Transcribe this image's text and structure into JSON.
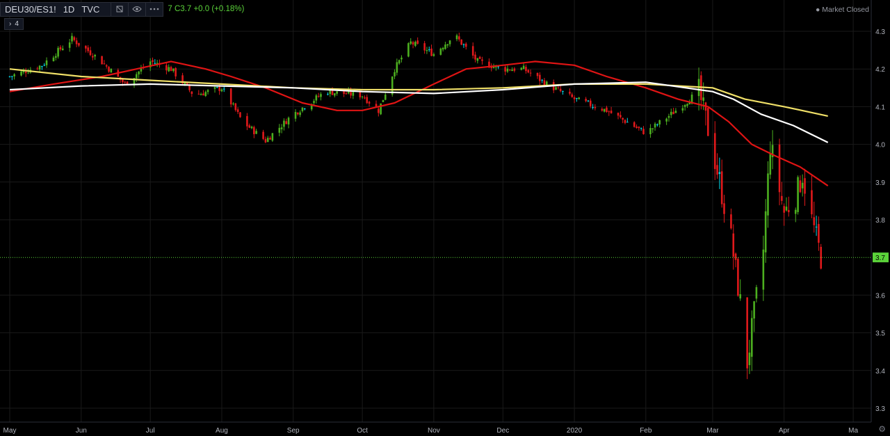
{
  "symbol": {
    "name": "DEU30/ES1!",
    "interval": "1D",
    "source": "TVC"
  },
  "ohlc_text": {
    "prefix": "7",
    "close": "C3.7",
    "change": "+0.0 (+0.18%)"
  },
  "indicators_toggle": "4",
  "market_status": "Market Closed",
  "icons": {
    "flag": "flag-icon",
    "eye": "eye-icon",
    "more": "more-icon",
    "gear": "gear-icon",
    "chevron": "chevron-right-icon"
  },
  "colors": {
    "background": "#000000",
    "grid": "#1a1a1a",
    "up": "#4caf1f",
    "down": "#e0191b",
    "doji": "#00d9e8",
    "ma_fast": "#e01414",
    "ma_mid": "#f0e068",
    "ma_slow": "#ffffff",
    "last_price": "#5bd33a",
    "axis_text": "#b2b5be"
  },
  "chart_data": {
    "type": "candlestick",
    "title": "DEU30/ES1!",
    "interval": "1D",
    "y_range": [
      3.29,
      4.33
    ],
    "x_range": [
      "2019-05-01",
      "2020-05-07"
    ],
    "y_ticks": [
      "4.3",
      "4.2",
      "4.1",
      "4.0",
      "3.9",
      "3.8",
      "3.6",
      "3.5",
      "3.4",
      "3.3"
    ],
    "x_ticks": [
      {
        "date": "2019-05-01",
        "label": "May"
      },
      {
        "date": "2019-06-01",
        "label": "Jun"
      },
      {
        "date": "2019-07-01",
        "label": "Jul"
      },
      {
        "date": "2019-08-01",
        "label": "Aug"
      },
      {
        "date": "2019-09-01",
        "label": "Sep"
      },
      {
        "date": "2019-10-01",
        "label": "Oct"
      },
      {
        "date": "2019-11-01",
        "label": "Nov"
      },
      {
        "date": "2019-12-01",
        "label": "Dec"
      },
      {
        "date": "2020-01-01",
        "label": "2020"
      },
      {
        "date": "2020-02-01",
        "label": "Feb"
      },
      {
        "date": "2020-03-01",
        "label": "Mar"
      },
      {
        "date": "2020-04-01",
        "label": "Apr"
      },
      {
        "date": "2020-05-01",
        "label": "Ma"
      }
    ],
    "last_price": {
      "value": 3.7,
      "label": "3.7"
    },
    "close_path": [
      [
        "2019-05-01",
        4.18
      ],
      [
        "2019-05-15",
        4.21
      ],
      [
        "2019-05-28",
        4.28
      ],
      [
        "2019-06-08",
        4.23
      ],
      [
        "2019-06-20",
        4.16
      ],
      [
        "2019-07-01",
        4.22
      ],
      [
        "2019-07-10",
        4.2
      ],
      [
        "2019-07-20",
        4.13
      ],
      [
        "2019-08-01",
        4.15
      ],
      [
        "2019-08-10",
        4.06
      ],
      [
        "2019-08-20",
        4.01
      ],
      [
        "2019-09-01",
        4.08
      ],
      [
        "2019-09-15",
        4.14
      ],
      [
        "2019-10-01",
        4.13
      ],
      [
        "2019-10-08",
        4.09
      ],
      [
        "2019-10-15",
        4.2
      ],
      [
        "2019-10-22",
        4.27
      ],
      [
        "2019-11-01",
        4.24
      ],
      [
        "2019-11-10",
        4.29
      ],
      [
        "2019-11-20",
        4.22
      ],
      [
        "2019-12-01",
        4.2
      ],
      [
        "2019-12-10",
        4.2
      ],
      [
        "2019-12-20",
        4.16
      ],
      [
        "2020-01-01",
        4.12
      ],
      [
        "2020-01-15",
        4.09
      ],
      [
        "2020-02-01",
        4.03
      ],
      [
        "2020-02-12",
        4.08
      ],
      [
        "2020-02-24",
        4.14
      ],
      [
        "2020-02-28",
        4.04
      ],
      [
        "2020-03-03",
        3.93
      ],
      [
        "2020-03-09",
        3.75
      ],
      [
        "2020-03-13",
        3.58
      ],
      [
        "2020-03-16",
        3.42
      ],
      [
        "2020-03-19",
        3.55
      ],
      [
        "2020-03-23",
        3.72
      ],
      [
        "2020-03-26",
        4.0
      ],
      [
        "2020-04-01",
        3.82
      ],
      [
        "2020-04-06",
        3.86
      ],
      [
        "2020-04-09",
        3.92
      ],
      [
        "2020-04-13",
        3.8
      ],
      [
        "2020-04-17",
        3.7
      ]
    ],
    "series": [
      {
        "name": "MA",
        "color_key": "ma_fast",
        "points": [
          [
            "2019-05-01",
            4.14
          ],
          [
            "2019-05-20",
            4.16
          ],
          [
            "2019-06-10",
            4.18
          ],
          [
            "2019-06-25",
            4.2
          ],
          [
            "2019-07-10",
            4.22
          ],
          [
            "2019-07-25",
            4.2
          ],
          [
            "2019-08-05",
            4.18
          ],
          [
            "2019-08-20",
            4.15
          ],
          [
            "2019-09-05",
            4.11
          ],
          [
            "2019-09-20",
            4.09
          ],
          [
            "2019-10-01",
            4.09
          ],
          [
            "2019-10-15",
            4.11
          ],
          [
            "2019-11-01",
            4.16
          ],
          [
            "2019-11-15",
            4.2
          ],
          [
            "2019-12-01",
            4.21
          ],
          [
            "2019-12-15",
            4.22
          ],
          [
            "2020-01-01",
            4.21
          ],
          [
            "2020-01-15",
            4.18
          ],
          [
            "2020-02-01",
            4.15
          ],
          [
            "2020-02-15",
            4.12
          ],
          [
            "2020-02-28",
            4.1
          ],
          [
            "2020-03-08",
            4.06
          ],
          [
            "2020-03-18",
            4.0
          ],
          [
            "2020-03-28",
            3.97
          ],
          [
            "2020-04-08",
            3.94
          ],
          [
            "2020-04-20",
            3.89
          ]
        ]
      },
      {
        "name": "MA",
        "color_key": "ma_mid",
        "points": [
          [
            "2019-05-01",
            4.2
          ],
          [
            "2019-06-01",
            4.18
          ],
          [
            "2019-07-01",
            4.17
          ],
          [
            "2019-08-01",
            4.16
          ],
          [
            "2019-09-01",
            4.15
          ],
          [
            "2019-10-01",
            4.145
          ],
          [
            "2019-11-01",
            4.145
          ],
          [
            "2019-12-01",
            4.15
          ],
          [
            "2020-01-01",
            4.16
          ],
          [
            "2020-02-01",
            4.16
          ],
          [
            "2020-03-01",
            4.15
          ],
          [
            "2020-03-15",
            4.12
          ],
          [
            "2020-04-01",
            4.1
          ],
          [
            "2020-04-20",
            4.075
          ]
        ]
      },
      {
        "name": "MA",
        "color_key": "ma_slow",
        "points": [
          [
            "2019-05-01",
            4.145
          ],
          [
            "2019-06-01",
            4.155
          ],
          [
            "2019-07-01",
            4.16
          ],
          [
            "2019-08-01",
            4.155
          ],
          [
            "2019-09-01",
            4.15
          ],
          [
            "2019-10-01",
            4.14
          ],
          [
            "2019-11-01",
            4.135
          ],
          [
            "2019-12-01",
            4.145
          ],
          [
            "2020-01-01",
            4.16
          ],
          [
            "2020-02-01",
            4.165
          ],
          [
            "2020-03-01",
            4.14
          ],
          [
            "2020-03-10",
            4.12
          ],
          [
            "2020-03-22",
            4.08
          ],
          [
            "2020-04-05",
            4.05
          ],
          [
            "2020-04-20",
            4.005
          ]
        ]
      }
    ]
  }
}
